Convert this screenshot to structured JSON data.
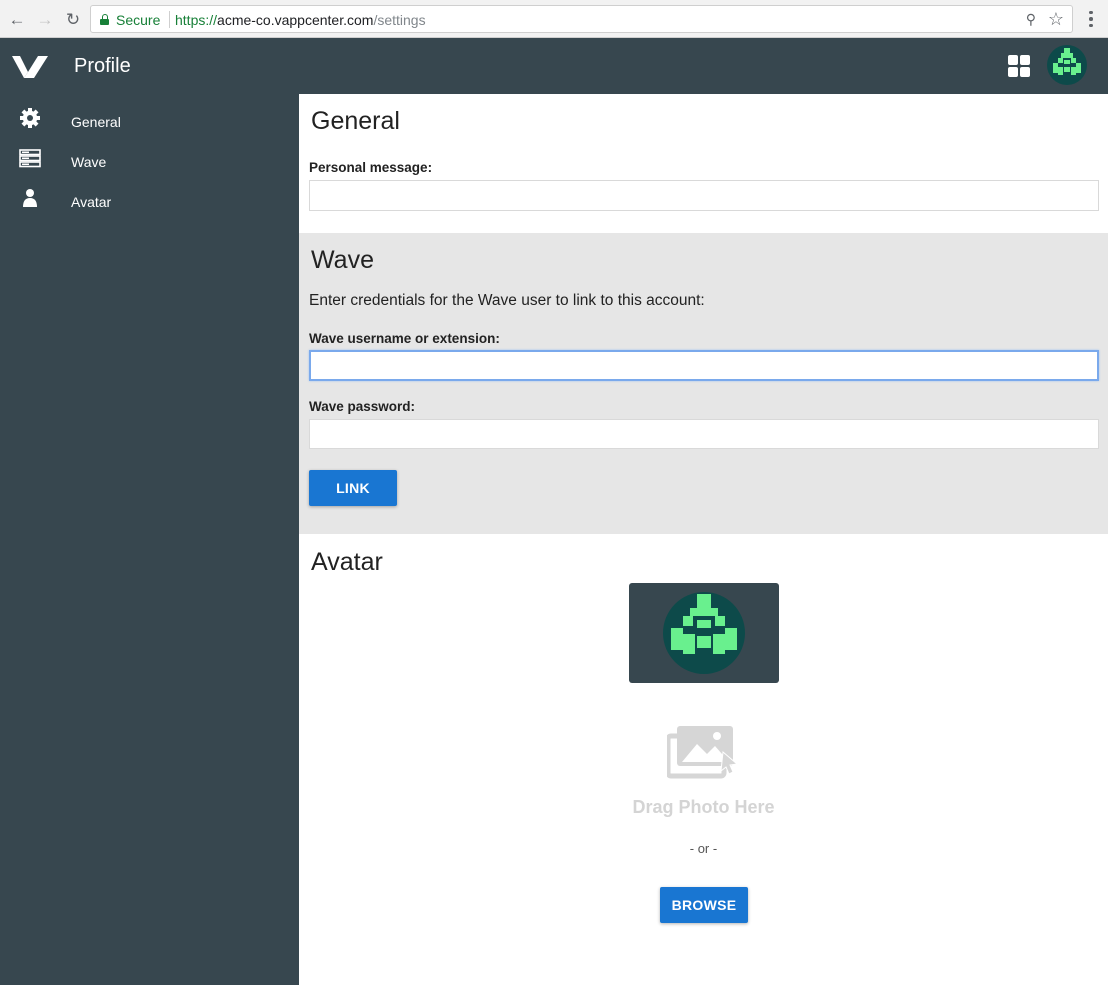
{
  "browser": {
    "secure_label": "Secure",
    "url_scheme": "https://",
    "url_host": "acme-co.vappcenter.com",
    "url_path": "/settings",
    "icons": [
      "back-arrow-icon",
      "forward-arrow-icon",
      "reload-icon",
      "lock-icon",
      "key-icon",
      "star-icon",
      "menu-dots-icon"
    ]
  },
  "header": {
    "title": "Profile",
    "color": "#37474f"
  },
  "sidebar": {
    "items": [
      {
        "label": "General",
        "icon": "gear-icon"
      },
      {
        "label": "Wave",
        "icon": "server-icon"
      },
      {
        "label": "Avatar",
        "icon": "person-icon"
      }
    ]
  },
  "general": {
    "title": "General",
    "personal_message_label": "Personal message:",
    "personal_message_value": ""
  },
  "wave": {
    "title": "Wave",
    "description": "Enter credentials for the Wave user to link to this account:",
    "username_label": "Wave username or extension:",
    "username_value": "",
    "password_label": "Wave password:",
    "password_value": "",
    "link_button": "LINK"
  },
  "avatar": {
    "title": "Avatar",
    "drag_text": "Drag Photo Here",
    "or_text": "- or -",
    "browse_button": "BROWSE",
    "avatar_colors": {
      "background": "#0d4a4a",
      "foreground": "#69f08e"
    }
  },
  "colors": {
    "accent": "#1976d2",
    "sidebar": "#37474f",
    "wave_section_bg": "#e6e6e6"
  }
}
